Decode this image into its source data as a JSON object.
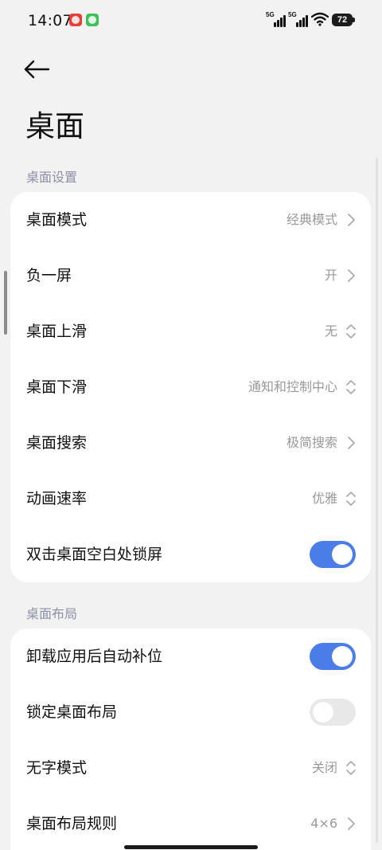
{
  "status_bar": {
    "time": "14:07",
    "signal1_label": "5G",
    "signal2_label": "5G",
    "battery": "72"
  },
  "header": {
    "title": "桌面"
  },
  "sections": [
    {
      "label": "桌面设置",
      "rows": [
        {
          "label": "桌面模式",
          "value": "经典模式",
          "control": "chevron-right"
        },
        {
          "label": "负一屏",
          "value": "开",
          "control": "chevron-right"
        },
        {
          "label": "桌面上滑",
          "value": "无",
          "control": "chevron-updown"
        },
        {
          "label": "桌面下滑",
          "value": "通知和控制中心",
          "control": "chevron-updown"
        },
        {
          "label": "桌面搜索",
          "value": "极简搜索",
          "control": "chevron-right"
        },
        {
          "label": "动画速率",
          "value": "优雅",
          "control": "chevron-updown"
        },
        {
          "label": "双击桌面空白处锁屏",
          "control": "toggle",
          "on": true
        }
      ]
    },
    {
      "label": "桌面布局",
      "rows": [
        {
          "label": "卸载应用后自动补位",
          "control": "toggle",
          "on": true
        },
        {
          "label": "锁定桌面布局",
          "control": "toggle",
          "on": false
        },
        {
          "label": "无字模式",
          "value": "关闭",
          "control": "chevron-updown"
        },
        {
          "label": "桌面布局规则",
          "value": "4×6",
          "control": "chevron-right"
        }
      ]
    }
  ],
  "colors": {
    "accent": "#4a7de8",
    "background": "#f2f2f2",
    "section_label": "#8a8fa6"
  }
}
